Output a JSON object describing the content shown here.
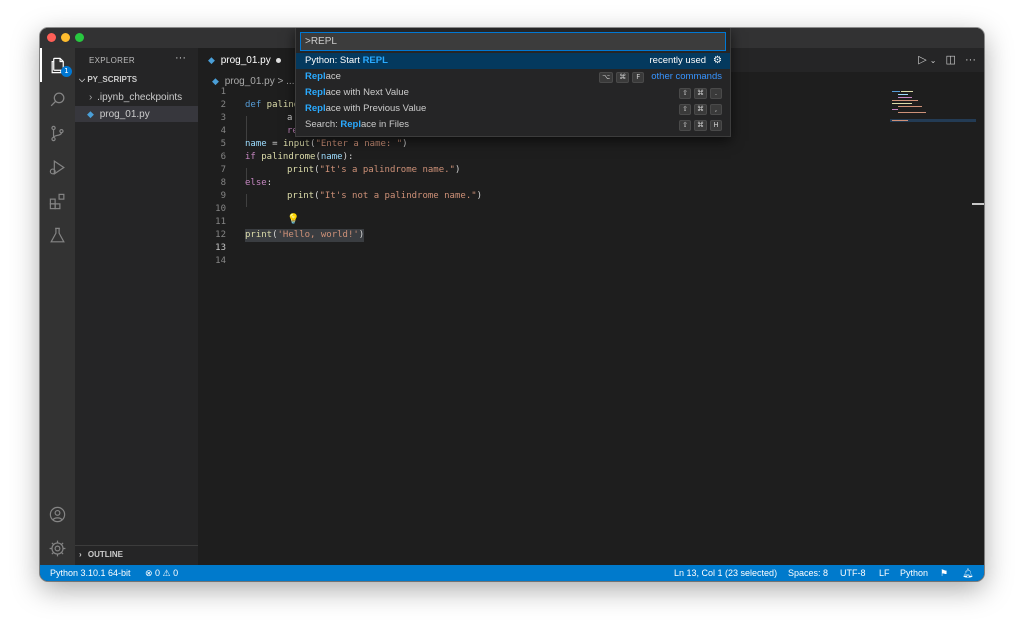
{
  "window": {
    "traffic_lights": {
      "close": "#ff5f57",
      "minimize": "#febc2e",
      "zoom": "#28c840"
    }
  },
  "activity_bar": {
    "explorer_badge": "1",
    "icons": [
      "explorer-icon",
      "search-icon",
      "source-control-icon",
      "run-debug-icon",
      "extensions-icon",
      "testing-icon",
      "account-icon",
      "settings-gear-icon"
    ]
  },
  "sidebar": {
    "title": "EXPLORER",
    "more": "···",
    "section": "PY_SCRIPTS",
    "items": [
      {
        "label": ".ipynb_checkpoints",
        "type": "folder"
      },
      {
        "label": "prog_01.py",
        "type": "file"
      }
    ],
    "outline": "OUTLINE"
  },
  "tab": {
    "label": "prog_01.py"
  },
  "breadcrumb": {
    "file": "prog_01.py",
    "sep": "> ..."
  },
  "editor": {
    "lines": [
      {
        "n": "1"
      },
      {
        "n": "2"
      },
      {
        "n": "3"
      },
      {
        "n": "4"
      },
      {
        "n": "5"
      },
      {
        "n": "6"
      },
      {
        "n": "7"
      },
      {
        "n": "8"
      },
      {
        "n": "9"
      },
      {
        "n": "10"
      },
      {
        "n": "11"
      },
      {
        "n": "12"
      },
      {
        "n": "13"
      },
      {
        "n": "14"
      }
    ],
    "code": {
      "l2_kw": "def",
      "l2_rest": " palind",
      "l3": "a",
      "l4": "re",
      "l5_var": "name",
      "l5_eq": " = ",
      "l5_fn": "input",
      "l5_p1": "(",
      "l5_str": "\"Enter a name: \"",
      "l5_p2": ")",
      "l6_kw": "if",
      "l6_fn": " palindrome",
      "l6_p1": "(",
      "l6_var": "name",
      "l6_p2": "):",
      "l7_fn": "print",
      "l7_p1": "(",
      "l7_str": "\"It's a palindrome name.\"",
      "l7_p2": ")",
      "l8_kw": "else",
      "l8_p": ":",
      "l9_fn": "print",
      "l9_p1": "(",
      "l9_str": "\"It's not a palindrome name.\"",
      "l9_p2": ")",
      "l12_fn": "print",
      "l12_p1": "(",
      "l12_str": "'Hello, world!'",
      "l12_p2": ")"
    },
    "lightbulb": "💡"
  },
  "command_palette": {
    "input_value": ">REPL",
    "items": [
      {
        "pre": "Python: Start ",
        "match": "REPL",
        "post": "",
        "right_text": "recently used",
        "focused": true
      },
      {
        "pre": "",
        "match": "Repl",
        "post": "ace",
        "keys": [
          "⌥",
          "⌘",
          "F"
        ],
        "right_link": "other commands"
      },
      {
        "pre": "",
        "match": "Repl",
        "post": "ace with Next Value",
        "keys": [
          "⇧",
          "⌘",
          "."
        ]
      },
      {
        "pre": "",
        "match": "Repl",
        "post": "ace with Previous Value",
        "keys": [
          "⇧",
          "⌘",
          ","
        ]
      },
      {
        "pre": "Search: ",
        "match": "Repl",
        "post": "ace in Files",
        "keys": [
          "⇧",
          "⌘",
          "H"
        ]
      }
    ]
  },
  "status_bar": {
    "interpreter": "Python 3.10.1 64-bit",
    "problems": "⊗ 0 ⚠ 0",
    "cursor": "Ln 13, Col 1 (23 selected)",
    "spaces": "Spaces: 8",
    "encoding": "UTF-8",
    "eol": "LF",
    "language": "Python",
    "accent": "#007acc"
  }
}
